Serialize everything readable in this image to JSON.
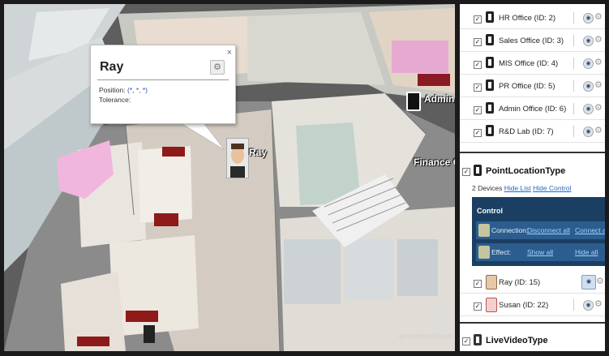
{
  "scene": {
    "popup": {
      "title": "Ray",
      "close_glyph": "×",
      "gear_glyph": "⚙",
      "position_label": "Position:",
      "position_value": "(*, *, *)",
      "tolerance_label": "Tolerance:"
    },
    "avatar_label": "Ray",
    "room_labels": [
      "Admin",
      "Finance O"
    ],
    "watermark": "germanium3d.com"
  },
  "panel": {
    "devices_top": [
      {
        "label": "HR Office (ID: 2)"
      },
      {
        "label": "Sales Office (ID: 3)"
      },
      {
        "label": "MIS Office (ID: 4)"
      },
      {
        "label": "PR Office (ID: 5)"
      },
      {
        "label": "Admin Office (ID: 6)"
      },
      {
        "label": "R&D Lab (ID: 7)"
      }
    ],
    "point_section": {
      "title": "PointLocationType",
      "count": "2 Devices",
      "hide_list": "Hide List",
      "hide_control": "Hide Control",
      "control_title": "Control",
      "connection_label": "Connection:",
      "disconnect_all": "Disconnect all",
      "connect_all": "Connect all",
      "effect_label": "Effect:",
      "show_all": "Show all",
      "hide_all": "Hide all",
      "persons": [
        {
          "label": "Ray (ID: 15)",
          "icon": "person-male-icon"
        },
        {
          "label": "Susan (ID: 22)",
          "icon": "person-female-icon"
        }
      ]
    },
    "video_section": {
      "title": "LiveVideoType"
    },
    "check_glyph": "✓",
    "eye_glyph": "◉",
    "gear_glyph": "⚙"
  }
}
